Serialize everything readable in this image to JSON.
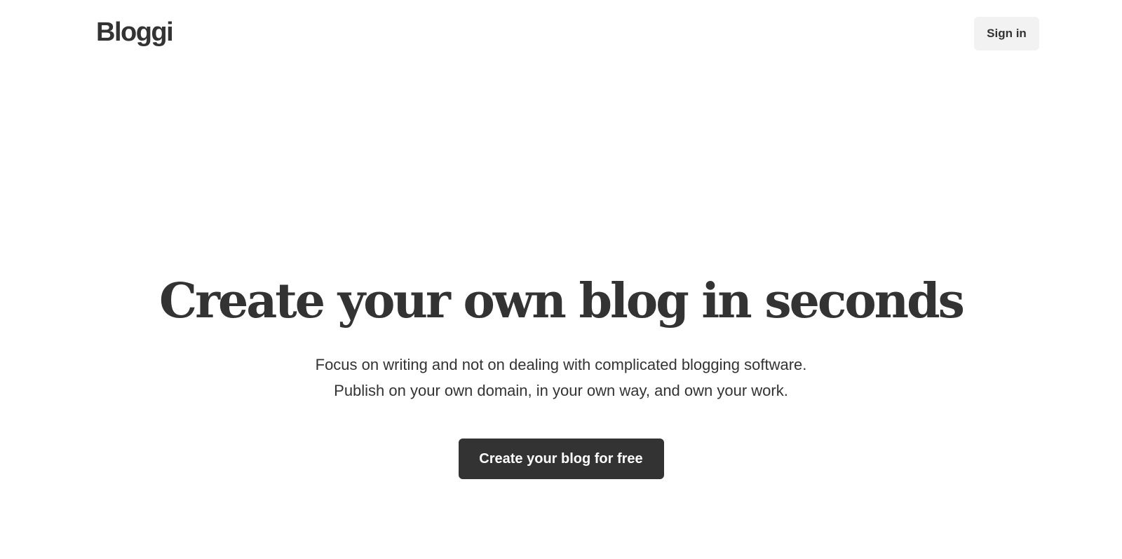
{
  "header": {
    "logo_text": "Bloggi",
    "signin_label": "Sign in"
  },
  "hero": {
    "headline": "Create your own blog in seconds",
    "subline_1": "Focus on writing and not on dealing with complicated blogging software.",
    "subline_2": "Publish on your own domain, in your own way, and own your work.",
    "cta_label": "Create your blog for free"
  },
  "colors": {
    "text": "#333333",
    "background": "#ffffff",
    "signin_bg": "#f2f2f2",
    "cta_bg": "#333333",
    "cta_text": "#ffffff"
  }
}
